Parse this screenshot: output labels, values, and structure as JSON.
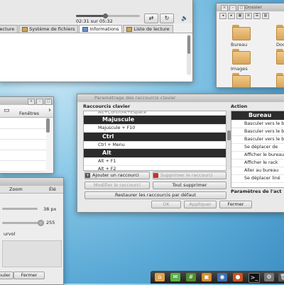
{
  "player": {
    "time": "02:31 sur 05:32",
    "progress": 0.45,
    "tabs": [
      "Lecture",
      "Système de fichiers",
      "Informations",
      "Liste de lecture"
    ],
    "active_tab": "Informations"
  },
  "files": {
    "title": "Dossier",
    "folders": [
      "Bureau",
      "Doc",
      "Images",
      ""
    ]
  },
  "panel": {
    "header": "Fenêtres"
  },
  "zoom": {
    "header_left": "Zoom",
    "header_right": "Élé",
    "value1": "38 px",
    "value2": "255",
    "label": "urvol",
    "cancel_label": "Annuler",
    "close_label": "Fermer"
  },
  "keyboard": {
    "title": "Paramétrage des raccourcis clavier",
    "left_header": "Raccourcis clavier",
    "right_header": "Action",
    "shortcuts": [
      {
        "text": "Alt+Contrôle+Espace",
        "type": "cut"
      },
      {
        "text": "Majuscule",
        "type": "group"
      },
      {
        "text": "Majuscule + F10",
        "type": "item"
      },
      {
        "text": "Ctrl",
        "type": "group"
      },
      {
        "text": "Ctrl + Menu",
        "type": "item"
      },
      {
        "text": "Alt",
        "type": "group"
      },
      {
        "text": "Alt + F1",
        "type": "item"
      },
      {
        "text": "Alt + F2",
        "type": "item"
      }
    ],
    "actions": [
      {
        "text": "Bureau",
        "type": "group"
      },
      {
        "text": "Basculer vers le b",
        "type": "item"
      },
      {
        "text": "Basculer vers le b",
        "type": "item"
      },
      {
        "text": "Basculer vers le b",
        "type": "item"
      },
      {
        "text": "Se déplacer de",
        "type": "item"
      },
      {
        "text": "Afficher le bureau",
        "type": "item"
      },
      {
        "text": "Afficher le rack",
        "type": "item"
      },
      {
        "text": "Aller au bureau",
        "type": "item"
      },
      {
        "text": "Se déplacer liné",
        "type": "item"
      }
    ],
    "add_label": "Ajouter un raccourci",
    "remove_label": "Supprimer le raccourci",
    "modify_label": "Modifier le raccourci",
    "delete_all_label": "Tout supprimer",
    "restore_label": "Restaurer les raccourcis par défaut",
    "action_params_label": "Paramètres de l'act",
    "ok_label": "OK",
    "apply_label": "Appliquer",
    "close_label": "Fermer"
  },
  "colors": {
    "accent_red": "#c8312b",
    "folder": "#e8b86a",
    "group_bg": "#2b2b2b"
  }
}
